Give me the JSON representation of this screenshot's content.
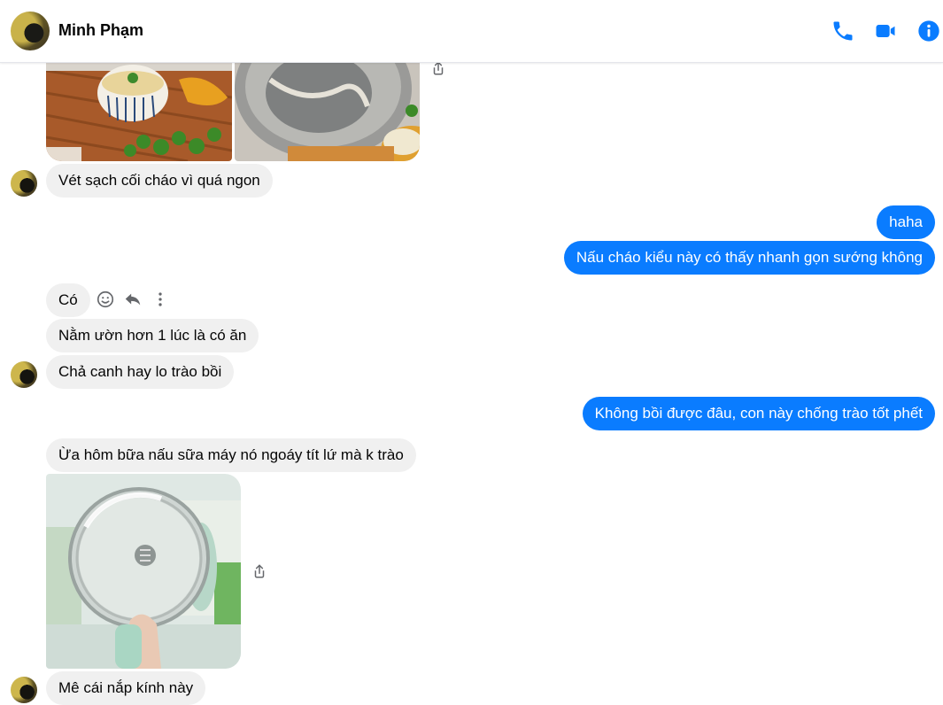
{
  "header": {
    "contact_name": "Minh Phạm",
    "icons": [
      "phone-icon",
      "video-camera-icon",
      "info-icon"
    ],
    "accent_color": "#0a7cff"
  },
  "messages": [
    {
      "from": "contact",
      "type": "images",
      "count": 2
    },
    {
      "from": "contact",
      "text": "Vét sạch cối cháo vì quá ngon"
    },
    {
      "from": "me",
      "text": "haha"
    },
    {
      "from": "me",
      "text": "Nấu cháo kiểu này có thấy nhanh gọn sướng không"
    },
    {
      "from": "contact",
      "text": "Có"
    },
    {
      "from": "contact",
      "text": "Nằm ườn hơn 1 lúc là có ăn"
    },
    {
      "from": "contact",
      "text": "Chả canh hay lo trào bồi"
    },
    {
      "from": "me",
      "text": "Không bồi được đâu, con này chống trào tốt phết"
    },
    {
      "from": "contact",
      "text": "Ừa hôm bữa nấu sữa máy nó ngoáy tít lứ mà k trào"
    },
    {
      "from": "contact",
      "type": "image",
      "count": 1
    },
    {
      "from": "contact",
      "text": "Mê cái nắp kính này"
    }
  ],
  "hover_actions": [
    "smiley-icon",
    "reply-icon",
    "more-options-icon"
  ]
}
